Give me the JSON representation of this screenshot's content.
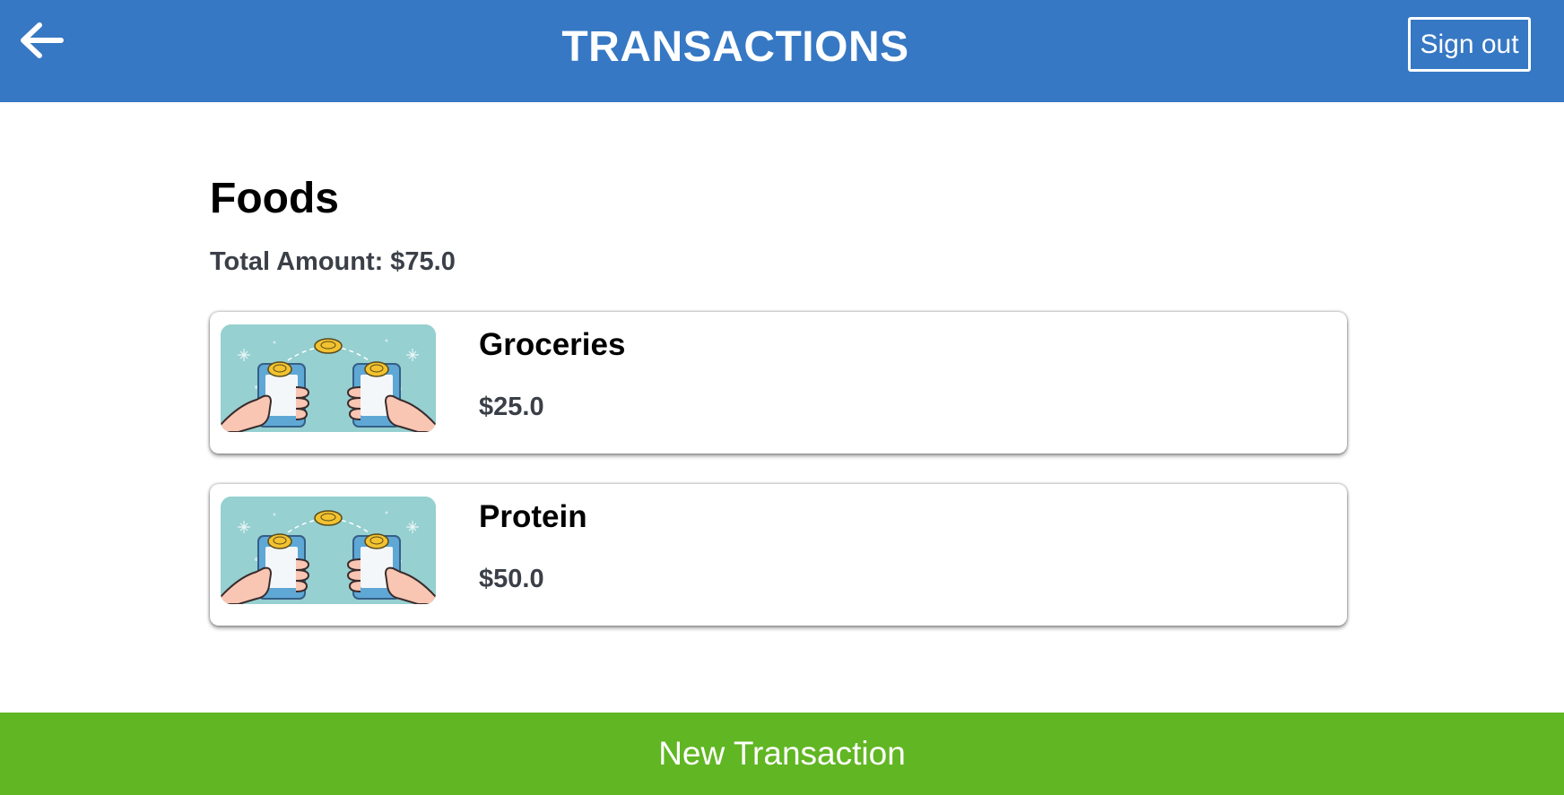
{
  "header": {
    "back_icon": "arrow-left-icon",
    "title": "TRANSACTIONS",
    "sign_out_label": "Sign out"
  },
  "category": {
    "name": "Foods",
    "total_label": "Total Amount:",
    "total_value": "$75.0"
  },
  "transactions": [
    {
      "name": "Groceries",
      "amount": "$25.0",
      "thumbnail_icon": "mobile-payment-illustration"
    },
    {
      "name": "Protein",
      "amount": "$50.0",
      "thumbnail_icon": "mobile-payment-illustration"
    }
  ],
  "footer": {
    "new_transaction_label": "New Transaction"
  },
  "colors": {
    "header_bg": "#3678c4",
    "footer_bg": "#61b623",
    "thumb_bg": "#96d0d1",
    "coin": "#f2c230"
  }
}
